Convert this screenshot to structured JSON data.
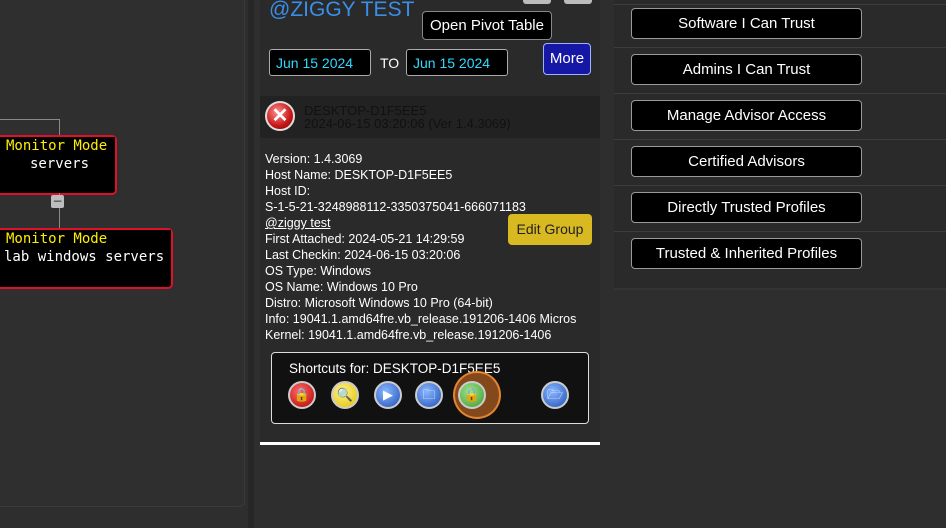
{
  "canvas": {
    "nodes": [
      {
        "mode": "Monitor Mode",
        "name": "servers"
      },
      {
        "mode": "Monitor Mode",
        "name": "lab windows servers"
      }
    ],
    "collapse_symbol": "−"
  },
  "panel": {
    "title": "@ZIGGY TEST",
    "pivot_label": "Open Pivot Table",
    "date_from": "Jun 15 2024",
    "to_label": "TO",
    "date_to": "Jun 15 2024",
    "more_label": "More",
    "host": {
      "name": "DESKTOP-D1F5EE5",
      "subtitle": "2024-06-15 03:20:06 (Ver 1.4.3069)",
      "status_icon": "error-x-icon",
      "status_symbol": "✕"
    },
    "details": [
      "Version: 1.4.3069",
      "Host Name: DESKTOP-D1F5EE5",
      "Host ID:",
      "S-1-5-21-3248988112-3350375041-666071183",
      "@ziggy test",
      "First Attached: 2024-05-21 14:29:59",
      "Last Checkin: 2024-06-15 03:20:06",
      "OS Type:  Windows",
      "OS Name:  Windows 10 Pro",
      "Distro:  Microsoft Windows 10 Pro (64-bit)",
      "Info:  19041.1.amd64fre.vb_release.191206-1406 Micros",
      "Kernel:  19041.1.amd64fre.vb_release.191206-1406"
    ],
    "edit_group_label": "Edit Group",
    "shortcuts_label": "Shortcuts for: DESKTOP-D1F5EE5",
    "shortcuts": [
      {
        "icon": "red-lock-icon",
        "glyph": "🔒"
      },
      {
        "icon": "magnifier-icon",
        "glyph": "🔍"
      },
      {
        "icon": "play-icon",
        "glyph": "▶"
      },
      {
        "icon": "folder-icon",
        "glyph": "🗀"
      },
      {
        "icon": "green-lock-icon",
        "glyph": "🔒"
      },
      {
        "icon": "folder-open-icon",
        "glyph": "🗁"
      }
    ],
    "highlight_color": "#e27828"
  },
  "right_menu": {
    "items": [
      "Software I Can Trust",
      "Admins I Can Trust",
      "Manage Advisor Access",
      "Certified Advisors",
      "Directly Trusted Profiles",
      "Trusted & Inherited Profiles"
    ]
  },
  "colors": {
    "title_blue": "#3a8ee8",
    "date_cyan": "#2fd8ff",
    "node_border": "#e0102a",
    "node_mode": "#ffee00",
    "edit_group": "#d9b922",
    "more_button": "#1717a6"
  }
}
